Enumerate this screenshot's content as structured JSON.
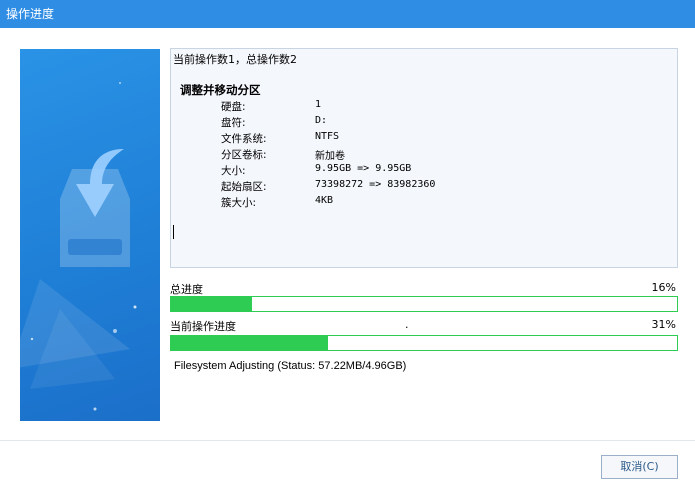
{
  "window": {
    "title": "操作进度"
  },
  "details": {
    "header": "当前操作数1，总操作数2",
    "operation_title": "调整并移动分区",
    "rows": [
      {
        "label": "硬盘:",
        "value": "1"
      },
      {
        "label": "盘符:",
        "value": "D:"
      },
      {
        "label": "文件系统:",
        "value": "NTFS"
      },
      {
        "label": "分区卷标:",
        "value": "新加卷"
      },
      {
        "label": "大小:",
        "value": "9.95GB => 9.95GB"
      },
      {
        "label": "起始扇区:",
        "value": "73398272 => 83982360"
      },
      {
        "label": "簇大小:",
        "value": "4KB"
      }
    ]
  },
  "progress": {
    "total": {
      "label": "总进度",
      "percent_text": "16%",
      "value": 0.16
    },
    "current": {
      "label": "当前操作进度",
      "marker": ".",
      "percent_text": "31%",
      "value": 0.31
    }
  },
  "status": {
    "text": "Filesystem Adjusting (Status: 57.22MB/4.96GB)"
  },
  "buttons": {
    "cancel": "取消(C)"
  },
  "colors": {
    "titlebar": "#2f8de4",
    "progress": "#2ecc52",
    "banner": "#1f7fd6"
  },
  "icons": {
    "banner": "download-to-disk-icon"
  }
}
